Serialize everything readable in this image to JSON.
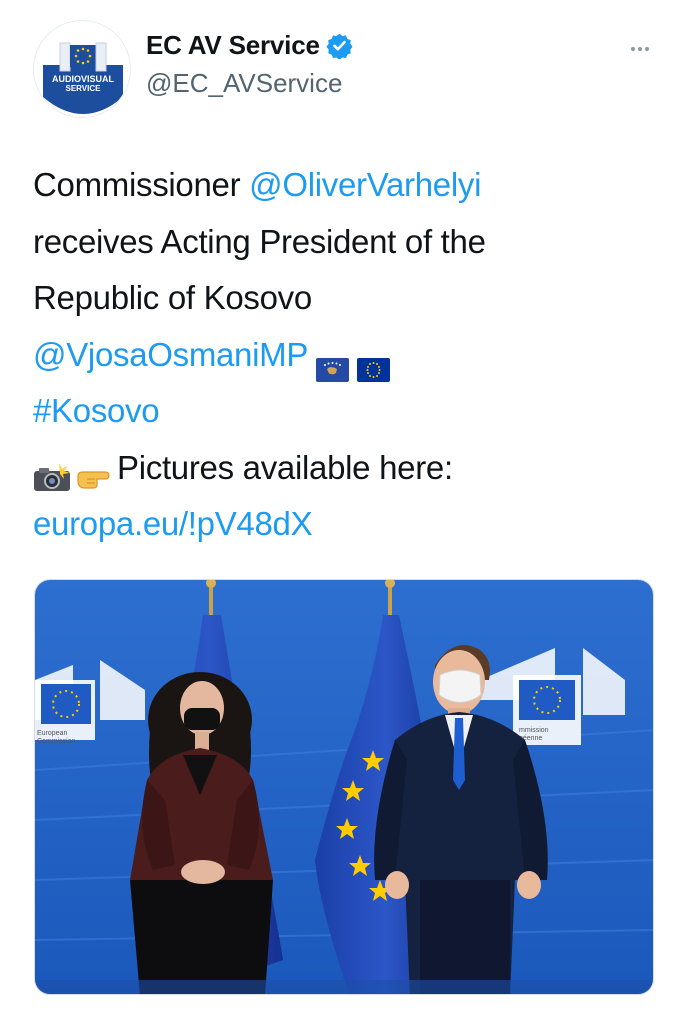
{
  "author": {
    "display_name": "EC AV Service",
    "handle": "@EC_AVService",
    "verified": true,
    "avatar_text_line1": "AUDIOVISUAL",
    "avatar_text_line2": "SERVICE"
  },
  "icons": {
    "verified": "verified-badge-icon",
    "more": "more-horizontal-icon"
  },
  "colors": {
    "link": "#1d9bf0",
    "eu_blue": "#003399",
    "eu_star": "#ffcc00"
  },
  "tweet": {
    "line1_prefix": "Commissioner ",
    "line1_mention": "@OliverVarhelyi",
    "line2": "receives Acting President of the",
    "line3": "Republic of Kosovo",
    "line4_mention": "@VjosaOsmaniMP",
    "line5_hashtag": "#Kosovo",
    "line6_text": "Pictures available here:",
    "line7_link": "europa.eu/!pV48dX"
  },
  "media": {
    "banner_left_line1": "European",
    "banner_left_line2": "Commission",
    "banner_right_line1": "mmission",
    "banner_right_line2": "péenne"
  }
}
